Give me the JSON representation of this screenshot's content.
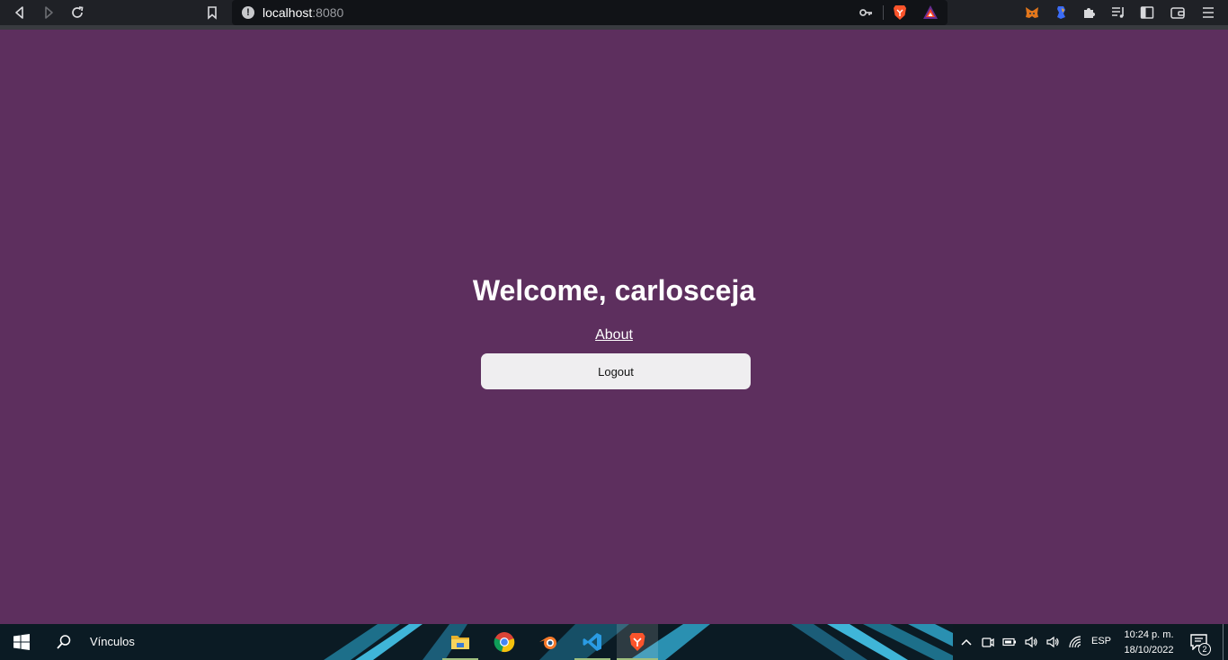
{
  "browser": {
    "url_host": "localhost",
    "url_port": ":8080",
    "url_info_glyph": "!",
    "icons": [
      "back-icon",
      "forward-icon",
      "reload-icon",
      "bookmark-icon",
      "key-icon",
      "brave-shields-icon",
      "brave-rewards-icon",
      "metamask-icon",
      "extension-blue-icon",
      "extensions-puzzle-icon",
      "reading-list-icon",
      "sidebar-icon",
      "wallet-icon",
      "menu-icon"
    ]
  },
  "page": {
    "welcome_text": "Welcome, carlosceja",
    "about_link": "About",
    "logout_label": "Logout",
    "background_color": "#5d2f5e"
  },
  "taskbar": {
    "links_label": "Vínculos",
    "apps": [
      "file-explorer-icon",
      "chrome-icon",
      "blender-icon",
      "vscode-icon",
      "brave-icon"
    ],
    "language": "ESP",
    "time": "10:24 p. m.",
    "date": "18/10/2022",
    "notification_count": "2"
  }
}
